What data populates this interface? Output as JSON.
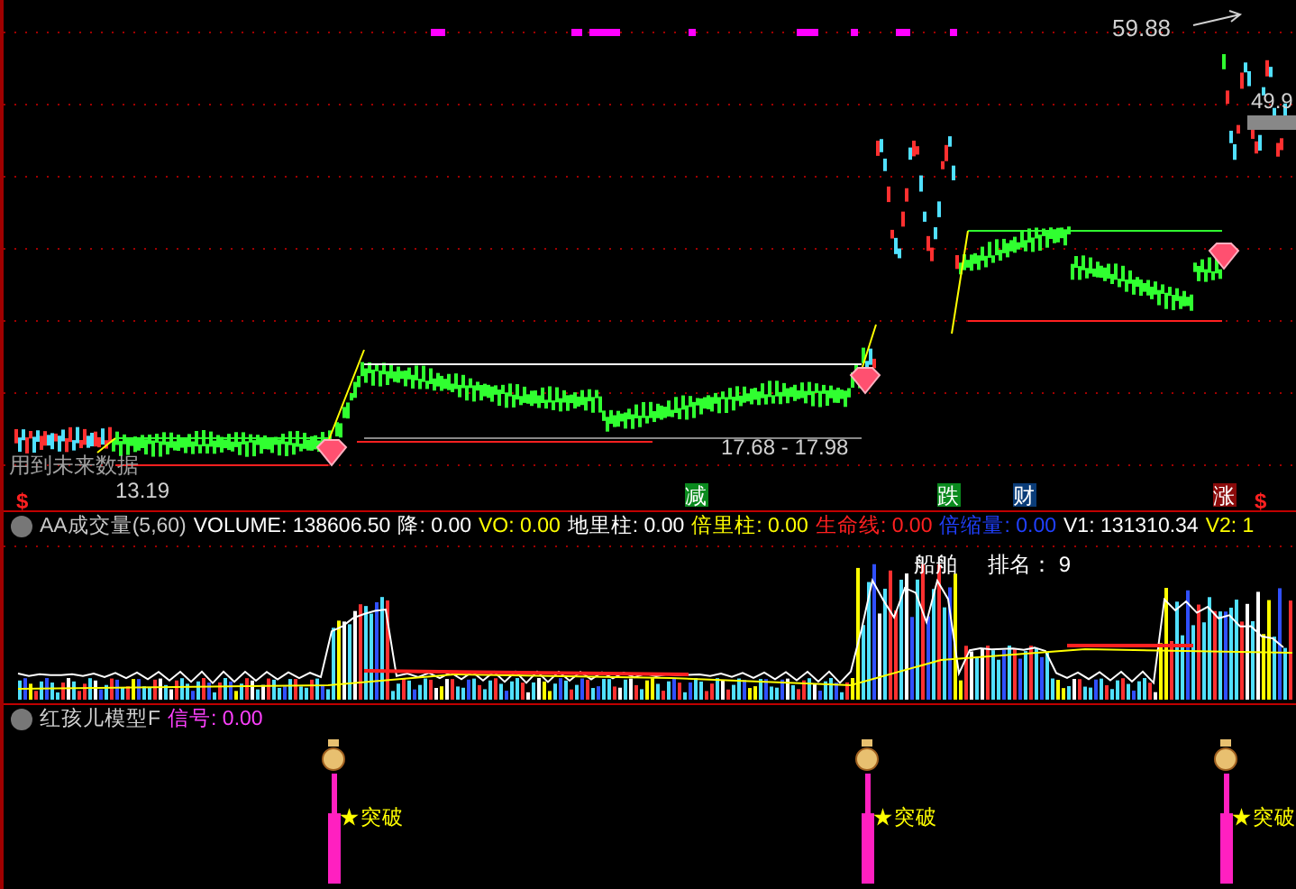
{
  "price_panel": {
    "high_label": "59.88",
    "last_label": "49.9",
    "low_label": "13.19",
    "range_label": "17.68 - 17.98",
    "warning": "用到未来数据",
    "markers": [
      {
        "text": "$",
        "kind": "plain",
        "color": "#ff2020"
      },
      {
        "text": "减",
        "kind": "boxed",
        "color": "#0a8a1e"
      },
      {
        "text": "跌",
        "kind": "boxed",
        "color": "#0a8a1e"
      },
      {
        "text": "财",
        "kind": "boxed",
        "color": "#0a3c78"
      },
      {
        "text": "涨",
        "kind": "boxed",
        "color": "#8a0a0a"
      },
      {
        "text": "$",
        "kind": "plain",
        "color": "#ff2020"
      }
    ]
  },
  "volume_panel": {
    "legend": [
      {
        "text": "AA成交量(5,60)",
        "color": "#c8c8c8"
      },
      {
        "text": "VOLUME: 138606.50",
        "color": "#ffffff"
      },
      {
        "text": "降: 0.00",
        "color": "#ffffff"
      },
      {
        "text": "VO: 0.00",
        "color": "#ffff00"
      },
      {
        "text": "地里柱: 0.00",
        "color": "#ffffff"
      },
      {
        "text": "倍里柱: 0.00",
        "color": "#ffff00"
      },
      {
        "text": "生命线: 0.00",
        "color": "#ff2020"
      },
      {
        "text": "倍缩量: 0.00",
        "color": "#2040ff"
      },
      {
        "text": "V1: 131310.34",
        "color": "#ffffff"
      },
      {
        "text": "V2: 1",
        "color": "#ffff00"
      }
    ],
    "industry": "船舶",
    "rank": "排名： 9"
  },
  "signal_panel": {
    "title": "红孩儿模型F",
    "signal_label": "信号: 0.00",
    "signals": [
      {
        "text": "★突破"
      },
      {
        "text": "★突破"
      },
      {
        "text": "★突破"
      }
    ]
  }
}
